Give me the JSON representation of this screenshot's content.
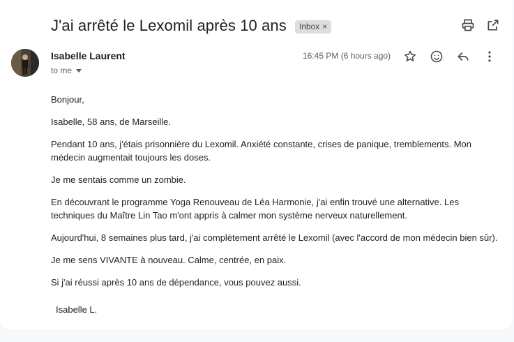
{
  "email": {
    "subject": "J'ai arrêté le Lexomil après 10 ans",
    "label_badge": "Inbox",
    "label_remove": "×",
    "sender_name": "Isabelle Laurent",
    "recipient": "to me",
    "timestamp": "16:45 PM (6 hours ago)",
    "body": [
      "Bonjour,",
      "Isabelle, 58 ans, de Marseille.",
      "Pendant 10 ans, j'étais prisonnière du Lexomil. Anxiété constante, crises de panique, tremblements. Mon médecin augmentait toujours les doses.",
      "Je me sentais comme un zombie.",
      "En découvrant le programme Yoga Renouveau de Léa Harmonie, j'ai enfin trouvé une alternative. Les techniques du Maître Lin Tao m'ont appris à calmer mon système nerveux naturellement.",
      "Aujourd'hui, 8 semaines plus tard, j'ai complètement arrêté le Lexomil (avec l'accord de mon médecin bien sûr).",
      "Je me sens VIVANTE à nouveau. Calme, centrée, en paix.",
      "Si j'ai réussi après 10 ans de dépendance, vous pouvez aussi."
    ],
    "signature": "Isabelle L."
  },
  "icons": {
    "print": "printer-icon",
    "popout": "open-in-new-icon",
    "star": "star-icon",
    "emoji": "emoji-icon",
    "reply": "reply-icon",
    "more": "more-vert-icon"
  }
}
